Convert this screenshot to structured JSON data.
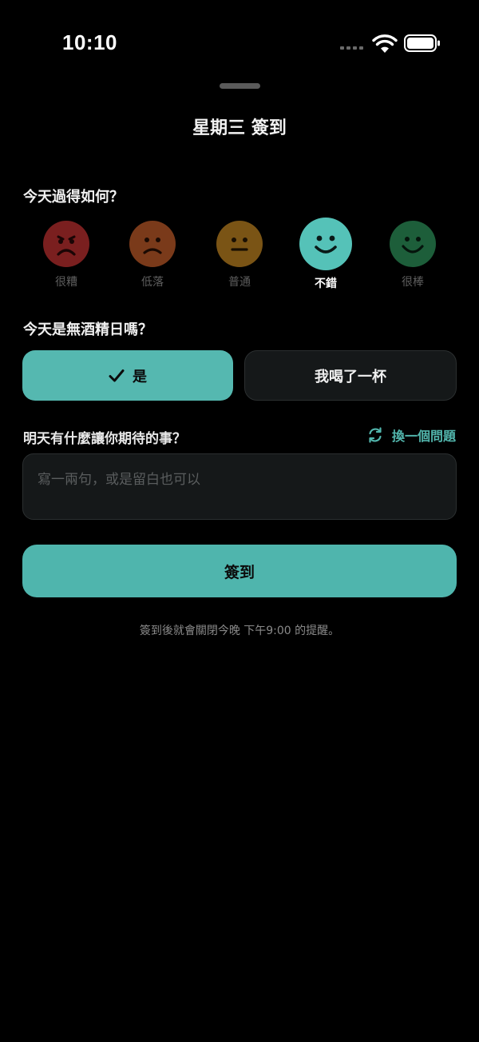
{
  "status_bar": {
    "time": "10:10",
    "icons": [
      "cellular-signal-icon",
      "wifi-icon",
      "battery-icon"
    ]
  },
  "sheet": {
    "title": "星期三 簽到"
  },
  "mood_section": {
    "question": "今天過得如何？",
    "selected": "不錯",
    "options": [
      {
        "label": "很糟",
        "expression": "very-sad",
        "color": "#7a1f1f"
      },
      {
        "label": "低落",
        "expression": "sad",
        "color": "#7a3a1a"
      },
      {
        "label": "普通",
        "expression": "neutral",
        "color": "#7a5415"
      },
      {
        "label": "不錯",
        "expression": "happy",
        "color": "#55c2b8"
      },
      {
        "label": "很棒",
        "expression": "very-happy",
        "color": "#1d5e3a"
      }
    ]
  },
  "alcohol_section": {
    "question": "今天是無酒精日嗎？",
    "yes_label": "是",
    "no_label": "我喝了一杯",
    "selected": "是"
  },
  "reflection_section": {
    "question": "明天有什麼讓你期待的事？",
    "swap_label": "換一個問題",
    "input_value": "",
    "input_placeholder": "寫一兩句，或是留白也可以"
  },
  "submit_label": "簽到",
  "footnote": "簽到後就會關閉今晚 下午9:00 的提醒。",
  "colors": {
    "accent": "#52b6ad",
    "background": "#000000",
    "card": "#151819"
  }
}
